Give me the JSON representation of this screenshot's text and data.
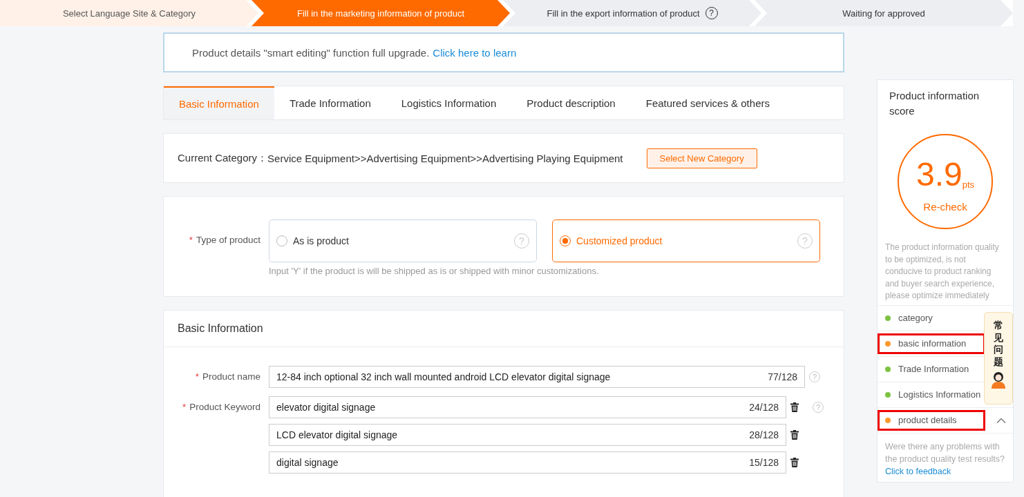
{
  "steps": [
    {
      "label": "Select Language Site & Category",
      "done": true,
      "selected": false
    },
    {
      "label": "Fill in the marketing information of product",
      "done": false,
      "selected": true
    },
    {
      "label": "Fill in the export information of product",
      "done": false,
      "selected": false,
      "help": "?"
    },
    {
      "label": "Waiting for approved",
      "done": false,
      "selected": false
    }
  ],
  "notice": {
    "text": "Product details \"smart editing\" function full upgrade.",
    "link": "Click here to learn"
  },
  "tabs": [
    {
      "label": "Basic Information",
      "selected": true
    },
    {
      "label": "Trade Information",
      "selected": false
    },
    {
      "label": "Logistics Information",
      "selected": false
    },
    {
      "label": "Product description",
      "selected": false
    },
    {
      "label": "Featured services & others",
      "selected": false
    }
  ],
  "category": {
    "label": "Current Category：",
    "path": "Service Equipment>>Advertising Equipment>>Advertising Playing Equipment",
    "button": "Select New Category"
  },
  "product_type": {
    "required_mark": "*",
    "label": "Type of product",
    "options": [
      {
        "label": "As is product",
        "selected": false,
        "help": "?"
      },
      {
        "label": "Customized product",
        "selected": true,
        "help": "?"
      }
    ],
    "hint": "Input 'Y' if the product is will be shipped as is or shipped with minor customizations."
  },
  "basic_section": {
    "title": "Basic Information",
    "product_name": {
      "required_mark": "*",
      "label": "Product name",
      "help": "?",
      "value": "12-84 inch optional 32 inch wall mounted android LCD elevator digital signage",
      "count": "77/128"
    },
    "keywords": {
      "required_mark": "*",
      "label": "Product Keyword",
      "help": "?",
      "items": [
        {
          "value": "elevator digital signage",
          "count": "24/128"
        },
        {
          "value": "LCD elevator digital signage",
          "count": "28/128"
        },
        {
          "value": "digital signage",
          "count": "15/128"
        }
      ]
    }
  },
  "score_panel": {
    "title": "Product information score",
    "score": "3.9",
    "unit": "pts",
    "recheck": "Re-check",
    "message": "The product information quality to be optimized, is not conducive to product ranking and buyer search experience, please optimize immediately",
    "items": [
      {
        "label": "category",
        "color": "#7cc242",
        "highlighted": false
      },
      {
        "label": "basic information",
        "color": "#ff9a2e",
        "highlighted": true
      },
      {
        "label": "Trade Information",
        "color": "#7cc242",
        "highlighted": false
      },
      {
        "label": "Logistics Information",
        "color": "#7cc242",
        "highlighted": false
      },
      {
        "label": "product details",
        "color": "#ff9a2e",
        "highlighted": true,
        "expanded": true
      }
    ],
    "feedback_text": "Were there any problems with the product quality test results?",
    "feedback_link": "Click to feedback"
  },
  "helper": {
    "text": "常见问题"
  }
}
